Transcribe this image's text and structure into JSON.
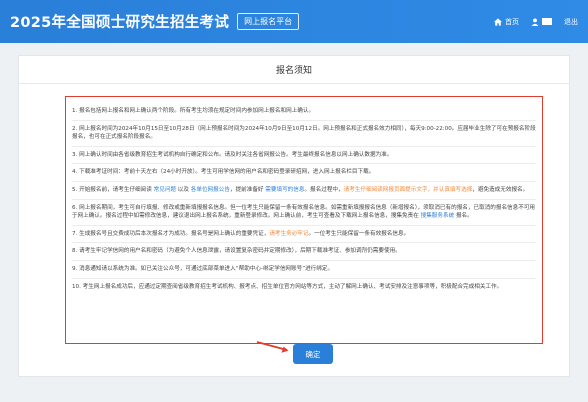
{
  "header": {
    "title": "2025年全国硕士研究生招生考试",
    "platform_badge": "网上报名平台",
    "nav": {
      "home_label": "首页",
      "logout_label": "退出"
    }
  },
  "notice": {
    "title": "报名须知",
    "rules": [
      {
        "parts": [
          {
            "text": "1. 报名包括网上报名和网上确认两个阶段。所有考生均须在规定时间内参加网上报名和网上确认。"
          }
        ]
      },
      {
        "parts": [
          {
            "text": "2. 网上报名时间为2024年10月15日至10月28日（网上预报名时间为2024年10月9日至10月12日。网上预报名和正式报名效力相同），每天9:00-22:00。应届毕业生除了可在预报名阶段报名，也可在正式报名阶段报名。"
          }
        ]
      },
      {
        "parts": [
          {
            "text": "3. 网上确认时间由各省级教育招生考试机构自行确定和公布。请及时关注各省网报公告。考生最终报名信息以网上确认数据为准。"
          }
        ]
      },
      {
        "parts": [
          {
            "text": "4. 下载准考证时间：考前十天左右（24小时开放）。考生可用学信网的用户名和密码登录研招网，进入网上报名栏目下载。"
          }
        ]
      },
      {
        "parts": [
          {
            "text": "5. 开始报名前，请考生仔细阅读 "
          },
          {
            "text": "常见问题",
            "style": "blue"
          },
          {
            "text": " 以及 "
          },
          {
            "text": "各单位网报公告",
            "style": "blue"
          },
          {
            "text": "，提前准备好 "
          },
          {
            "text": "需要填写的信息",
            "style": "blue"
          },
          {
            "text": "。报名过程中，"
          },
          {
            "text": "请考生仔细阅读网报页面提示文字，并认真填写选择",
            "style": "orange"
          },
          {
            "text": "，避免造成无效报名。"
          }
        ]
      },
      {
        "parts": [
          {
            "text": "6. 网上报名期间，考生可自行填报、修改或重新填报报名信息。但一位考生只能保留一条有效报名信息。如需重新填报报名信息（新增报名），须取消已有的报名，已取消的报名信息不可用于网上确认。报名过程中如需修改信息，建议退出网上报名系统，重新登录修改。网上确认前，考生可查看及下载网上报名信息，搜集免责在 "
          },
          {
            "text": "搜集服务系统",
            "style": "blue"
          },
          {
            "text": " 报名。"
          }
        ]
      },
      {
        "parts": [
          {
            "text": "7. 生成报名号且交费成功后本次报名才为成功。报名号是网上确认的重要凭证，"
          },
          {
            "text": "请考生务必牢记",
            "style": "orange"
          },
          {
            "text": "。一位考生只能保留一条有效报名信息。"
          }
        ]
      },
      {
        "parts": [
          {
            "text": "8. 请考生牢记学信网的用户名和密码（为避免个人信息泄露，请设置复杂密码并定期修改），后期下载准考证、参加调剂仍需要使用。"
          }
        ]
      },
      {
        "parts": [
          {
            "text": "9. 消息通知请以系统为准。如已关注公众号，可通过底部菜单进入“帮助中心-绑定学信网账号”进行绑定。"
          }
        ]
      },
      {
        "parts": [
          {
            "text": "10. 考生网上报名成功后，应通过定期查阅省级教育招生考试机构、报考点、招生单位官方网站等方式，主动了解网上确认、考试安排及注意事项等，积极配合完成相关工作。"
          }
        ]
      }
    ],
    "confirm_label": "确定"
  },
  "colors": {
    "header_bg": "#2f8be6",
    "accent_blue": "#2a7fd8",
    "highlight_border": "#e33b2d",
    "warning_text": "#f0883a"
  },
  "icons": [
    "home-icon",
    "user-icon",
    "arrow-pointer-icon"
  ]
}
